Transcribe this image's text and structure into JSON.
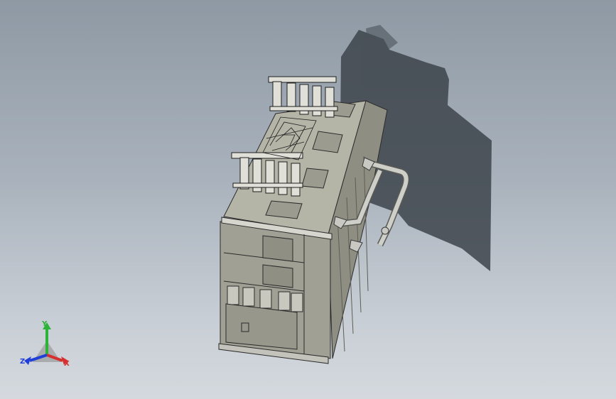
{
  "triad": {
    "x_label": "X",
    "y_label": "Y",
    "z_label": "Z",
    "x_color": "#d43030",
    "y_color": "#2db33a",
    "z_color": "#1f3fd6"
  },
  "colors": {
    "body": "#a7a79a",
    "body_dark": "#7f7f74",
    "edge": "#2b2b2b",
    "shadow": "#3d444b",
    "pipe": "#c9c9c4"
  }
}
